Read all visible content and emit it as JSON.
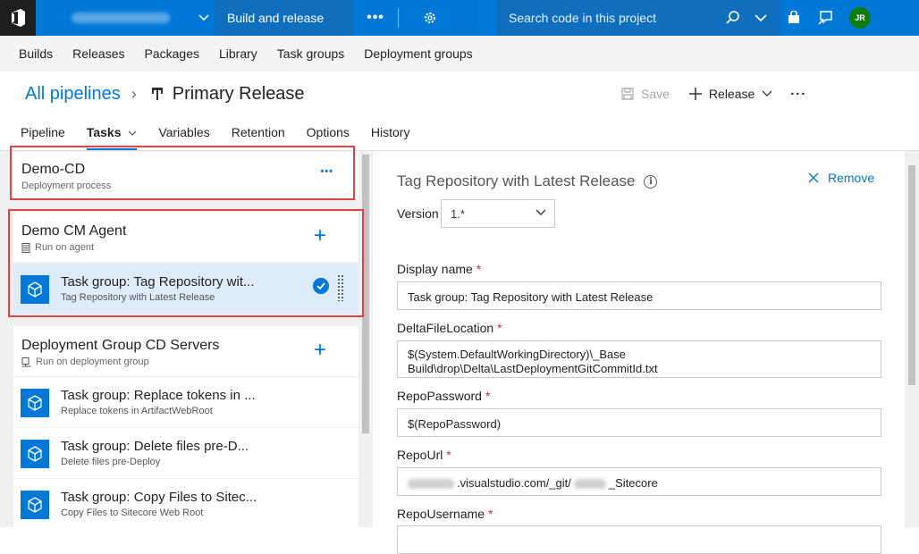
{
  "topbar": {
    "hub_label": "Build and release",
    "more": "•••",
    "search_placeholder": "Search code in this project",
    "avatar_initials": "JR"
  },
  "subnav": [
    "Builds",
    "Releases",
    "Packages",
    "Library",
    "Task groups",
    "Deployment groups"
  ],
  "header": {
    "breadcrumb": "All pipelines",
    "breadcrumb_sep": "›",
    "title": "Primary Release",
    "save_label": "Save",
    "release_label": "Release",
    "more": "···"
  },
  "tabs": [
    "Pipeline",
    "Tasks",
    "Variables",
    "Retention",
    "Options",
    "History"
  ],
  "left": {
    "process": {
      "title": "Demo-CD",
      "subtitle": "Deployment process",
      "more": "•••"
    },
    "agent": {
      "title": "Demo CM Agent",
      "subtitle": "Run on agent"
    },
    "agent_tasks": [
      {
        "title": "Task group: Tag Repository wit...",
        "subtitle": "Tag Repository with Latest Release"
      }
    ],
    "group": {
      "title": "Deployment Group CD Servers",
      "subtitle": "Run on deployment group"
    },
    "group_tasks": [
      {
        "title": "Task group: Replace tokens in ...",
        "subtitle": "Replace tokens in ArtifactWebRoot"
      },
      {
        "title": "Task group: Delete files pre-D...",
        "subtitle": "Delete files pre-Deploy"
      },
      {
        "title": "Task group: Copy Files to Sitec...",
        "subtitle": "Copy Files to Sitecore Web Root"
      }
    ]
  },
  "detail": {
    "heading": "Tag Repository with Latest Release",
    "info": "i",
    "remove_label": "Remove",
    "version_label": "Version",
    "version_value": "1.*",
    "required_mark": "*",
    "fields": {
      "display_name": {
        "label": "Display name",
        "value": "Task group: Tag Repository with Latest Release"
      },
      "delta": {
        "label": "DeltaFileLocation",
        "value_line1": "$(System.DefaultWorkingDirectory)\\_Base",
        "value_line2": "Build\\drop\\Delta\\LastDeploymentGitCommitId.txt"
      },
      "repo_password": {
        "label": "RepoPassword",
        "value": "$(RepoPassword)"
      },
      "repo_url": {
        "label": "RepoUrl",
        "value_mid": ".visualstudio.com/_git/",
        "value_end": "_Sitecore"
      },
      "repo_username": {
        "label": "RepoUsername"
      }
    }
  },
  "colors": {
    "accent": "#0078d7",
    "highlight": "#e04343",
    "selected_row": "#deecf9"
  }
}
